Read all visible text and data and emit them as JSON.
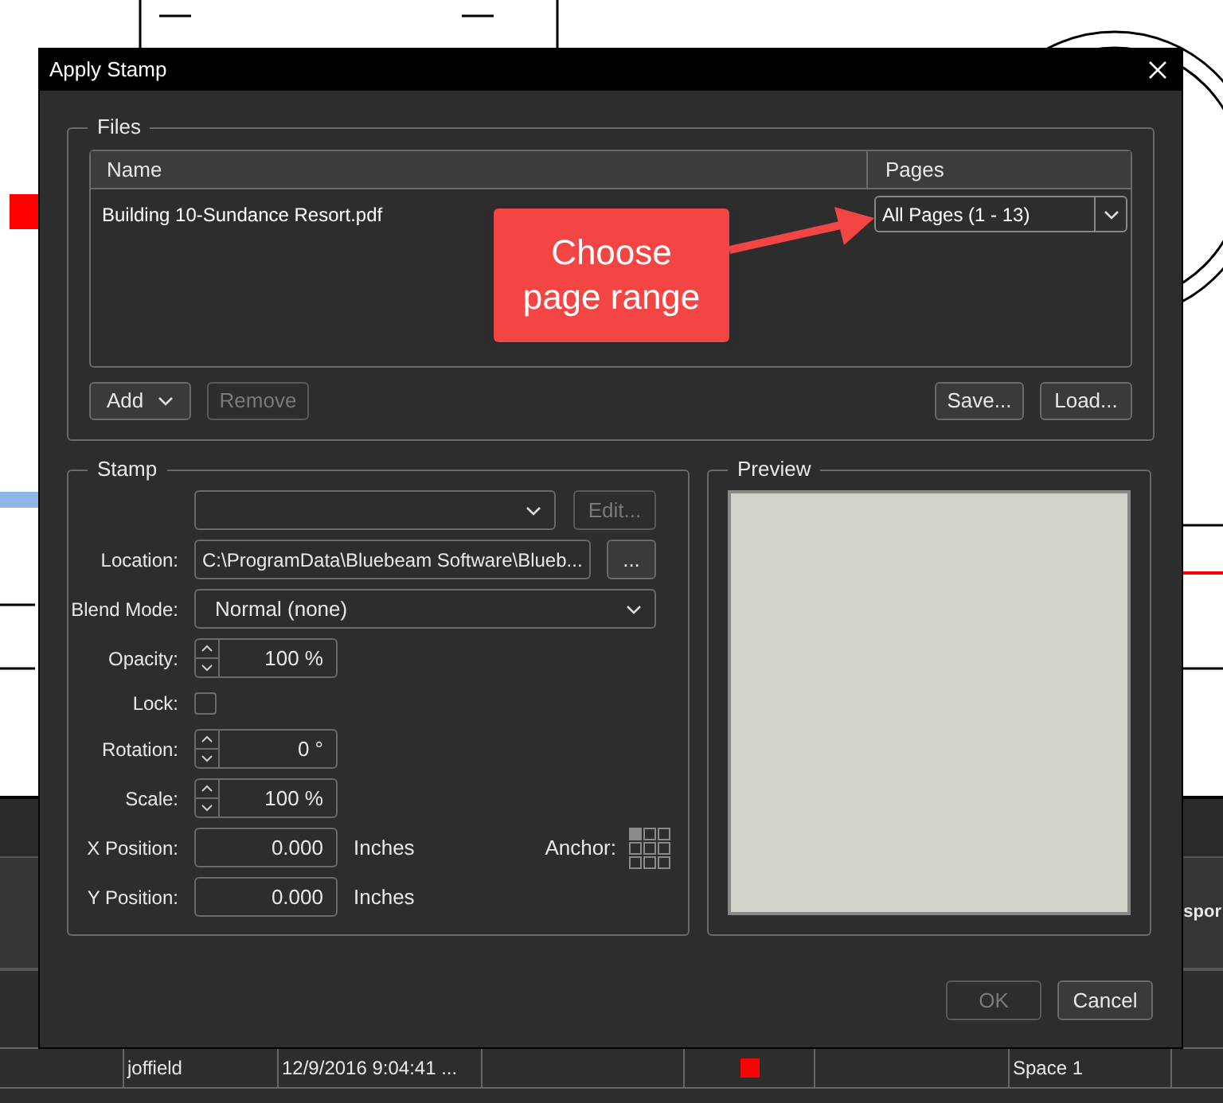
{
  "background": {
    "header_fragment": "spor",
    "row": [
      {
        "kind": "text",
        "text": "joffield"
      },
      {
        "kind": "text",
        "text": "12/9/2016 9:04:41 ..."
      },
      {
        "kind": "empty"
      },
      {
        "kind": "swatch",
        "color": "#ff0000"
      },
      {
        "kind": "empty"
      },
      {
        "kind": "text",
        "text": "Space 1"
      }
    ]
  },
  "dialog": {
    "title": "Apply Stamp",
    "files": {
      "legend": "Files",
      "columns": [
        "Name",
        "Pages"
      ],
      "rows": [
        {
          "name": "Building 10-Sundance Resort.pdf",
          "pages": "All Pages (1 - 13)"
        }
      ],
      "add": {
        "label": "Add",
        "disabled": false
      },
      "remove": {
        "label": "Remove",
        "disabled": true
      },
      "save": {
        "label": "Save...",
        "disabled": false
      },
      "load": {
        "label": "Load...",
        "disabled": false
      }
    },
    "callout": "Choose\npage range",
    "stamp": {
      "legend": "Stamp",
      "rows": [
        {
          "kind": "select",
          "label": "",
          "value": "",
          "button": {
            "label": "Edit...",
            "disabled": true
          }
        },
        {
          "kind": "path",
          "label": "Location:",
          "value": "C:\\ProgramData\\Bluebeam Software\\Blueb...",
          "button": {
            "label": "...",
            "disabled": false
          }
        },
        {
          "kind": "select",
          "label": "Blend Mode:",
          "value": "Normal (none)"
        },
        {
          "kind": "spinner",
          "label": "Opacity:",
          "value": "100 %"
        },
        {
          "kind": "checkbox",
          "label": "Lock:",
          "checked": false
        },
        {
          "kind": "spinner",
          "label": "Rotation:",
          "value": "0 °"
        },
        {
          "kind": "spinner",
          "label": "Scale:",
          "value": "100 %"
        },
        {
          "kind": "number",
          "label": "X Position:",
          "value": "0.000",
          "unit": "Inches"
        },
        {
          "kind": "number",
          "label": "Y Position:",
          "value": "0.000",
          "unit": "Inches"
        }
      ],
      "anchor": {
        "label": "Anchor:",
        "cells": [
          {
            "selected": true
          },
          {
            "selected": false
          },
          {
            "selected": false
          },
          {
            "selected": false
          },
          {
            "selected": false
          },
          {
            "selected": false
          },
          {
            "selected": false
          },
          {
            "selected": false
          },
          {
            "selected": false
          }
        ]
      }
    },
    "preview": {
      "legend": "Preview"
    },
    "ok": {
      "label": "OK",
      "disabled": true
    },
    "cancel": {
      "label": "Cancel",
      "disabled": false
    }
  }
}
